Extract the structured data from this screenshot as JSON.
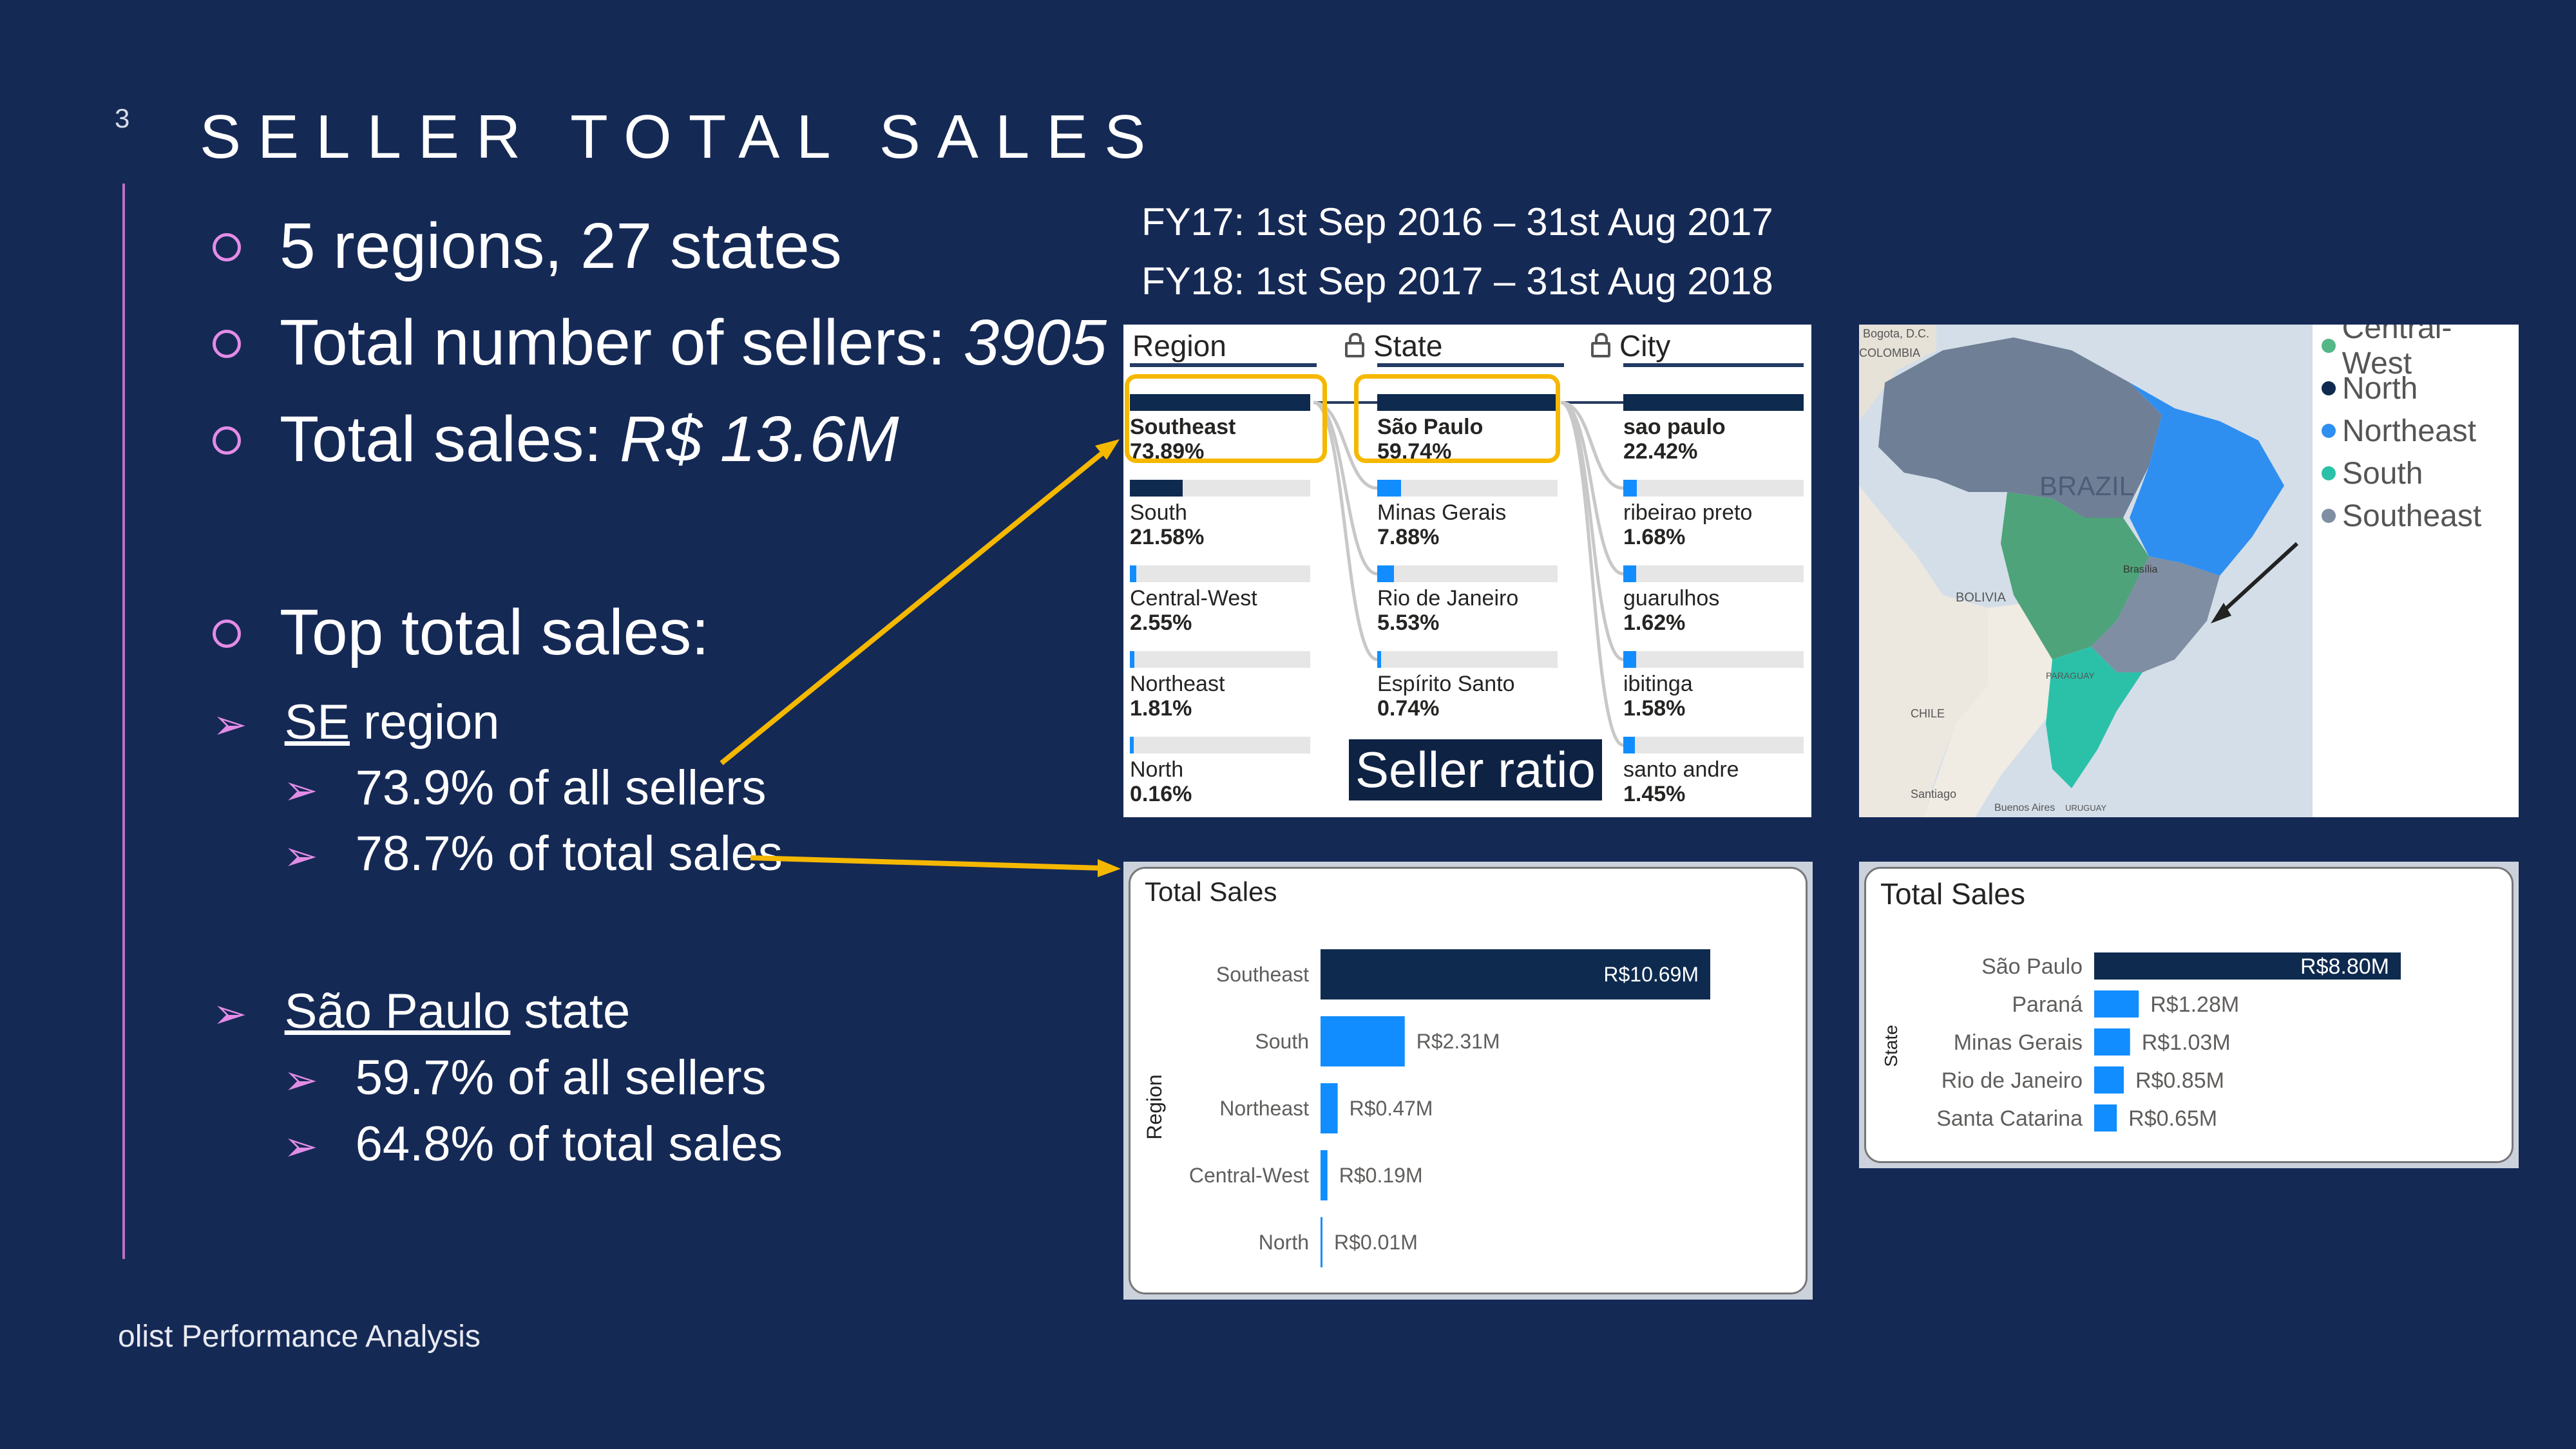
{
  "slide": {
    "page_number": "3",
    "title": "SELLER TOTAL SALES",
    "footer": "olist Performance Analysis"
  },
  "bullets": {
    "regions": "5 regions, 27 states",
    "sellers_label": "Total number of sellers: ",
    "sellers_value": "3905",
    "sales_label": "Total sales: ",
    "sales_value": "R$ 13.6M",
    "top_label": "Top total sales:",
    "se_link": "SE",
    "se_rest": " region",
    "se_sellers": "73.9% of all sellers",
    "se_sales": "78.7% of total sales",
    "sp_link": "São Paulo",
    "sp_rest": " state",
    "sp_sellers": "59.7% of all sellers",
    "sp_sales": "64.8% of total sales"
  },
  "fiscal": {
    "fy17": "FY17: 1st Sep 2016 – 31st Aug 2017",
    "fy18": "FY18: 1st Sep 2017 – 31st Aug 2018"
  },
  "tree": {
    "headers": [
      "Region",
      "State",
      "City"
    ],
    "caption": "Seller ratio",
    "colors": {
      "dark": "#0e2a4f",
      "blue": "#118dff",
      "highlight": "#f5b800"
    },
    "region": [
      {
        "label": "Southeast",
        "pct": "73.89%",
        "value": 73.89,
        "selected": true
      },
      {
        "label": "South",
        "pct": "21.58%",
        "value": 21.58
      },
      {
        "label": "Central-West",
        "pct": "2.55%",
        "value": 2.55
      },
      {
        "label": "Northeast",
        "pct": "1.81%",
        "value": 1.81
      },
      {
        "label": "North",
        "pct": "0.16%",
        "value": 0.16
      }
    ],
    "state": [
      {
        "label": "São Paulo",
        "pct": "59.74%",
        "value": 59.74,
        "selected": true
      },
      {
        "label": "Minas Gerais",
        "pct": "7.88%",
        "value": 7.88
      },
      {
        "label": "Rio de Janeiro",
        "pct": "5.53%",
        "value": 5.53
      },
      {
        "label": "Espírito Santo",
        "pct": "0.74%",
        "value": 0.74
      }
    ],
    "city": [
      {
        "label": "sao paulo",
        "pct": "22.42%",
        "value": 22.42,
        "selected": true
      },
      {
        "label": "ribeirao preto",
        "pct": "1.68%",
        "value": 1.68
      },
      {
        "label": "guarulhos",
        "pct": "1.62%",
        "value": 1.62
      },
      {
        "label": "ibitinga",
        "pct": "1.58%",
        "value": 1.58
      },
      {
        "label": "santo andre",
        "pct": "1.45%",
        "value": 1.45
      }
    ]
  },
  "map": {
    "country_label": "BRAZIL",
    "place_labels": [
      "Bogota, D.C.",
      "COLOMBIA",
      "BOLIVIA",
      "PARAGUAY",
      "CHILE",
      "Santiago",
      "Buenos Aires",
      "URUGUAY",
      "Brasília"
    ],
    "legend": [
      {
        "label": "Central-West",
        "color": "#53b787"
      },
      {
        "label": "North",
        "color": "#0e2a4f"
      },
      {
        "label": "Northeast",
        "color": "#2f8ff0"
      },
      {
        "label": "South",
        "color": "#2bc1a9"
      },
      {
        "label": "Southeast",
        "color": "#7f8ea2"
      }
    ]
  },
  "chart_data": [
    {
      "type": "bar",
      "orientation": "horizontal",
      "title": "Total Sales",
      "ylabel": "Region",
      "categories": [
        "Southeast",
        "South",
        "Northeast",
        "Central-West",
        "North"
      ],
      "values": [
        10.69,
        2.31,
        0.47,
        0.19,
        0.01
      ],
      "labels": [
        "R$10.69M",
        "R$2.31M",
        "R$0.47M",
        "R$0.19M",
        "R$0.01M"
      ],
      "unit": "R$M"
    },
    {
      "type": "bar",
      "orientation": "horizontal",
      "title": "Total Sales",
      "ylabel": "State",
      "categories": [
        "São Paulo",
        "Paraná",
        "Minas Gerais",
        "Rio de Janeiro",
        "Santa Catarina"
      ],
      "values": [
        8.8,
        1.28,
        1.03,
        0.85,
        0.65
      ],
      "labels": [
        "R$8.80M",
        "R$1.28M",
        "R$1.03M",
        "R$0.85M",
        "R$0.65M"
      ],
      "unit": "R$M"
    }
  ]
}
